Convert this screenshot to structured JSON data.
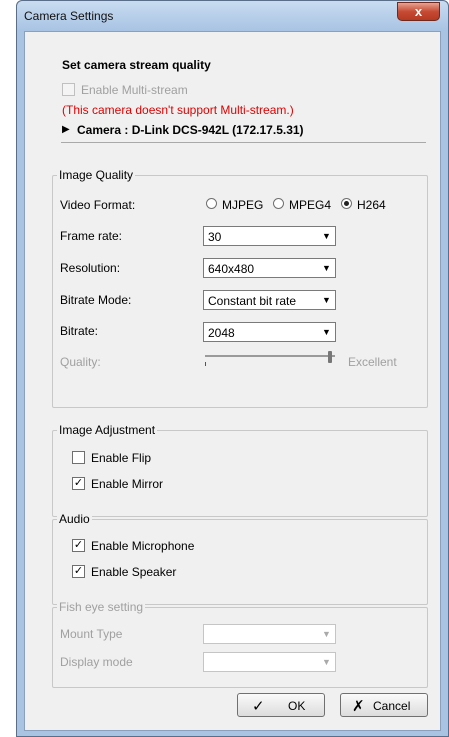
{
  "window": {
    "title": "Camera Settings",
    "close_glyph": "x"
  },
  "header": {
    "heading": "Set camera stream quality",
    "multi_stream_label": "Enable Multi-stream",
    "warning": "(This camera doesn't support Multi-stream.)",
    "camera_arrow": "▶",
    "camera_label": "Camera : D-Link DCS-942L (172.17.5.31)"
  },
  "image_quality": {
    "title": "Image Quality",
    "video_format_label": "Video Format:",
    "formats": [
      "MJPEG",
      "MPEG4",
      "H264"
    ],
    "selected_format": "H264",
    "frame_rate_label": "Frame rate:",
    "frame_rate_value": "30",
    "resolution_label": "Resolution:",
    "resolution_value": "640x480",
    "bitrate_mode_label": "Bitrate Mode:",
    "bitrate_mode_value": "Constant bit rate",
    "bitrate_label": "Bitrate:",
    "bitrate_value": "2048",
    "quality_label": "Quality:",
    "quality_max_label": "Excellent",
    "quality_level": 1.0
  },
  "image_adjustment": {
    "title": "Image Adjustment",
    "flip_label": "Enable Flip",
    "flip_checked": false,
    "mirror_label": "Enable Mirror",
    "mirror_checked": true
  },
  "audio": {
    "title": "Audio",
    "microphone_label": "Enable Microphone",
    "microphone_checked": true,
    "speaker_label": "Enable Speaker",
    "speaker_checked": true
  },
  "fisheye": {
    "title": "Fish eye setting",
    "mount_type_label": "Mount Type",
    "mount_type_value": "",
    "display_mode_label": "Display mode",
    "display_mode_value": ""
  },
  "buttons": {
    "ok_icon": "✓",
    "ok_label": "OK",
    "cancel_icon": "✗",
    "cancel_label": "Cancel"
  },
  "icons": {
    "dropdown": "▼",
    "check": "✓"
  }
}
